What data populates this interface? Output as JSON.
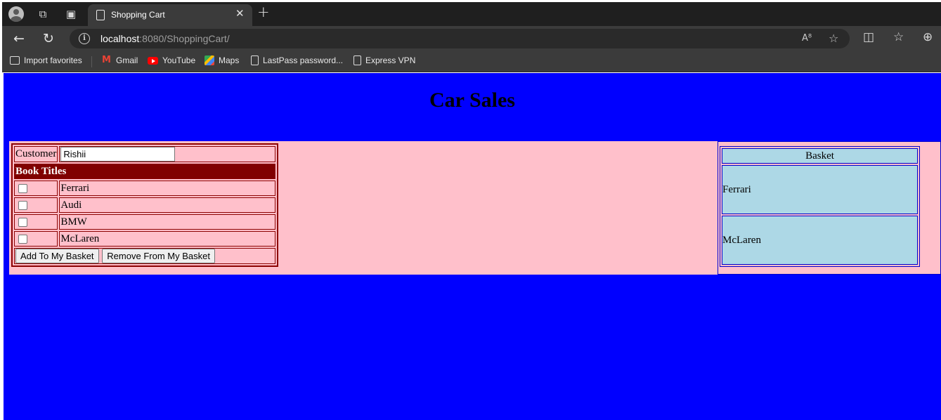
{
  "browser": {
    "tab_title": "Shopping Cart",
    "url_host": "localhost",
    "url_path": ":8080/ShoppingCart/",
    "bookmarks": [
      {
        "label": "Import favorites",
        "icon": "folder-icon"
      },
      {
        "label": "Gmail",
        "icon": "gmail-icon"
      },
      {
        "label": "YouTube",
        "icon": "youtube-icon"
      },
      {
        "label": "Maps",
        "icon": "maps-icon"
      },
      {
        "label": "LastPass password...",
        "icon": "doc-icon"
      },
      {
        "label": "Express VPN",
        "icon": "doc-icon"
      }
    ]
  },
  "page": {
    "title": "Car Sales",
    "background_color": "#0000ff",
    "panel_color": "#ffc0cb"
  },
  "form": {
    "customer_label": "Customer",
    "customer_value": "Rishii",
    "list_heading": "Book Titles",
    "items": [
      {
        "label": "Ferrari",
        "checked": false
      },
      {
        "label": "Audi",
        "checked": false
      },
      {
        "label": "BMW",
        "checked": false
      },
      {
        "label": "McLaren",
        "checked": false
      }
    ],
    "add_button": "Add To My Basket",
    "remove_button": "Remove From My Basket"
  },
  "basket": {
    "heading": "Basket",
    "items": [
      "Ferrari",
      "McLaren"
    ]
  }
}
